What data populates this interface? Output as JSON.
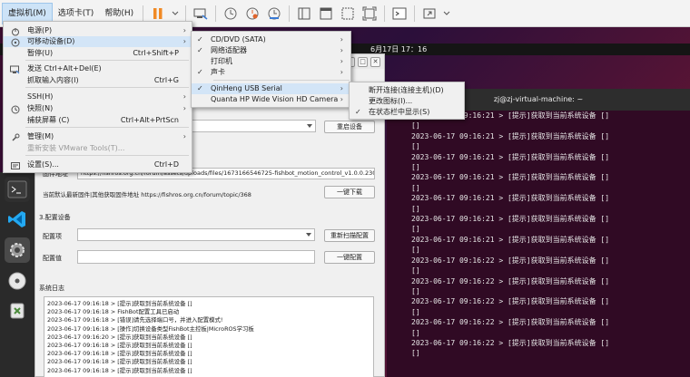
{
  "toolbar": {
    "menus": [
      {
        "label": "虚拟机(M)"
      },
      {
        "label": "选项卡(T)"
      },
      {
        "label": "帮助(H)"
      }
    ],
    "icons": [
      "pause-icon",
      "send-ctrl-alt-del-icon",
      "snapshot-icon",
      "revert-snapshot-icon",
      "snapshot-manager-icon",
      "library-icon",
      "single-window-icon",
      "unity-icon",
      "fullscreen-icon",
      "console-icon",
      "stretch-icon"
    ]
  },
  "guest": {
    "clock": "6月17日  17：16",
    "terminal": {
      "title": "zj@zj-virtual-machine: ~",
      "lines": [
        "2023-06-17 09:16:21 > [提示]获取到当前系统设备 []",
        "[]",
        "2023-06-17 09:16:21 > [提示]获取到当前系统设备 []",
        "[]",
        "2023-06-17 09:16:21 > [提示]获取到当前系统设备 []",
        "[]",
        "2023-06-17 09:16:21 > [提示]获取到当前系统设备 []",
        "[]",
        "2023-06-17 09:16:21 > [提示]获取到当前系统设备 []",
        "[]",
        "2023-06-17 09:16:21 > [提示]获取到当前系统设备 []",
        "[]",
        "2023-06-17 09:16:21 > [提示]获取到当前系统设备 []",
        "[]",
        "2023-06-17 09:16:22 > [提示]获取到当前系统设备 []",
        "[]",
        "2023-06-17 09:16:22 > [提示]获取到当前系统设备 []",
        "[]",
        "2023-06-17 09:16:22 > [提示]获取到当前系统设备 []",
        "[]",
        "2023-06-17 09:16:22 > [提示]获取到当前系统设备 []",
        "[]",
        "2023-06-17 09:16:22 > [提示]获取到当前系统设备 []",
        "[]"
      ]
    },
    "app": {
      "reconnect_button": "重启设备",
      "firmware_label": "固件地址",
      "firmware_url": "https://fishros.org.cn/forum/assets/uploads/files/1673166546725-fishbot_motion_control_v1.0.0.230108.bin",
      "firmware_note": "当前默认最新固件|其他获取固件地址 https://fishros.org.cn/forum/topic/368",
      "download_button": "一键下载",
      "config_section": "3.配置设备",
      "config_item_label": "配置项",
      "config_value_label": "配置值",
      "rescan_button": "重新扫描配置",
      "apply_button": "一键配置",
      "log_title": "系统日志",
      "log_lines": [
        "2023-06-17 09:16:18 > [提示]获取到当前系统设备 []",
        "2023-06-17 09:16:18 > FishBot配置工具已启动",
        "2023-06-17 09:16:18 > [错误]请先选择端口号，并进入配置模式!",
        "2023-06-17 09:16:18 > [操作]切换设备类型FishBot主控板|MicroROS学习板",
        "2023-06-17 09:16:20 > [提示]获取到当前系统设备 []",
        "2023-06-17 09:16:18 > [提示]获取到当前系统设备 []",
        "2023-06-17 09:16:18 > [提示]获取到当前系统设备 []",
        "2023-06-17 09:16:18 > [提示]获取到当前系统设备 []",
        "2023-06-17 09:16:18 > [提示]获取到当前系统设备 []"
      ]
    }
  },
  "vm_menu": {
    "items": [
      {
        "label": "电源(P)",
        "shortcut": "",
        "submenu": true,
        "icon": "power-icon"
      },
      {
        "label": "可移动设备(D)",
        "shortcut": "",
        "submenu": true,
        "icon": "removable-devices-icon"
      },
      {
        "label": "暂停(U)",
        "shortcut": "Ctrl+Shift+P",
        "submenu": false,
        "icon": ""
      },
      {
        "label": "发送 Ctrl+Alt+Del(E)",
        "shortcut": "",
        "submenu": false,
        "icon": "keyboard-icon"
      },
      {
        "label": "抓取输入内容(I)",
        "shortcut": "Ctrl+G",
        "submenu": false,
        "icon": ""
      },
      {
        "label": "SSH(H)",
        "shortcut": "",
        "submenu": true,
        "icon": ""
      },
      {
        "label": "快照(N)",
        "shortcut": "",
        "submenu": true,
        "icon": "snapshot-icon"
      },
      {
        "label": "捕获屏幕 (C)",
        "shortcut": "Ctrl+Alt+PrtScn",
        "submenu": false,
        "icon": ""
      },
      {
        "label": "管理(M)",
        "shortcut": "",
        "submenu": true,
        "icon": "wrench-icon"
      },
      {
        "label": "重新安装 VMware Tools(T)...",
        "shortcut": "",
        "submenu": false,
        "icon": ""
      },
      {
        "label": "设置(S)...",
        "shortcut": "Ctrl+D",
        "submenu": false,
        "icon": "settings-icon"
      }
    ]
  },
  "devices_menu": {
    "items": [
      {
        "label": "CD/DVD (SATA)",
        "checked": true
      },
      {
        "label": "网络适配器",
        "checked": true
      },
      {
        "label": "打印机",
        "checked": false
      },
      {
        "label": "声卡",
        "checked": true
      },
      {
        "label": "QinHeng USB Serial",
        "checked": true
      },
      {
        "label": "Quanta HP Wide Vision HD Camera",
        "checked": false
      }
    ]
  },
  "usb_menu": {
    "items": [
      {
        "label": "断开连接(连接主机)(D)",
        "checked": false
      },
      {
        "label": "更改图标(I)...",
        "checked": false
      },
      {
        "label": "在状态栏中显示(S)",
        "checked": true
      }
    ]
  }
}
